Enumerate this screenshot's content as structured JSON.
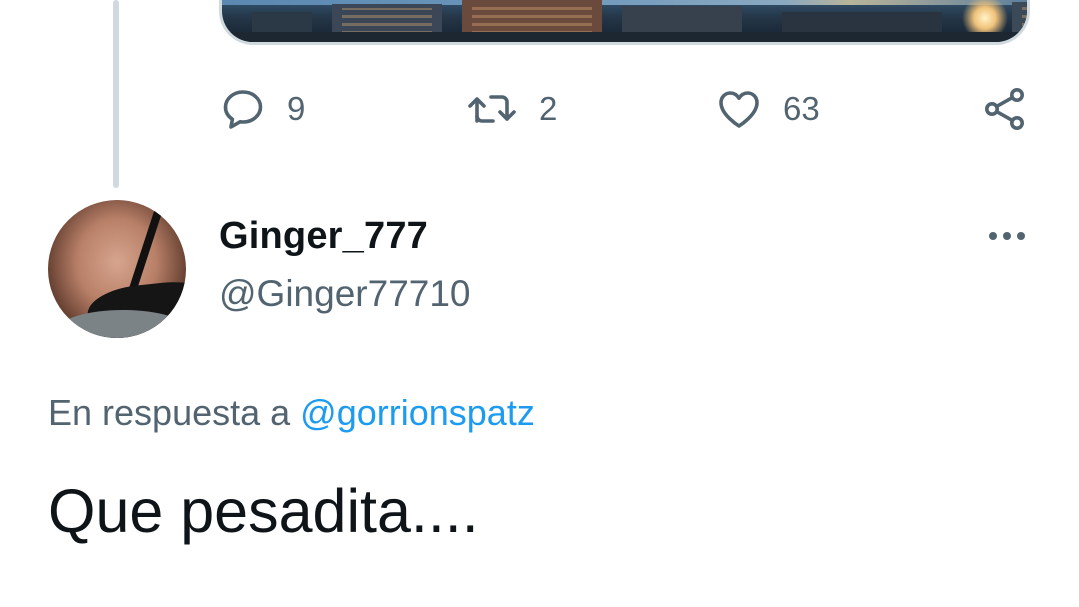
{
  "previous_tweet": {
    "actions": {
      "reply_count": "9",
      "retweet_count": "2",
      "like_count": "63"
    }
  },
  "tweet": {
    "display_name": "Ginger_777",
    "handle": "@Ginger77710",
    "reply_prefix": "En respuesta a",
    "reply_to": "@gorrionspatz",
    "text": "Que pesadita...."
  },
  "colors": {
    "primary_text": "#0f1419",
    "secondary_text": "#536471",
    "accent": "#1d9bf0",
    "thread_line": "#cfd9de"
  },
  "icons": {
    "reply": "reply-icon",
    "retweet": "retweet-icon",
    "like": "heart-icon",
    "share": "share-icon",
    "more": "more-dots-icon"
  }
}
